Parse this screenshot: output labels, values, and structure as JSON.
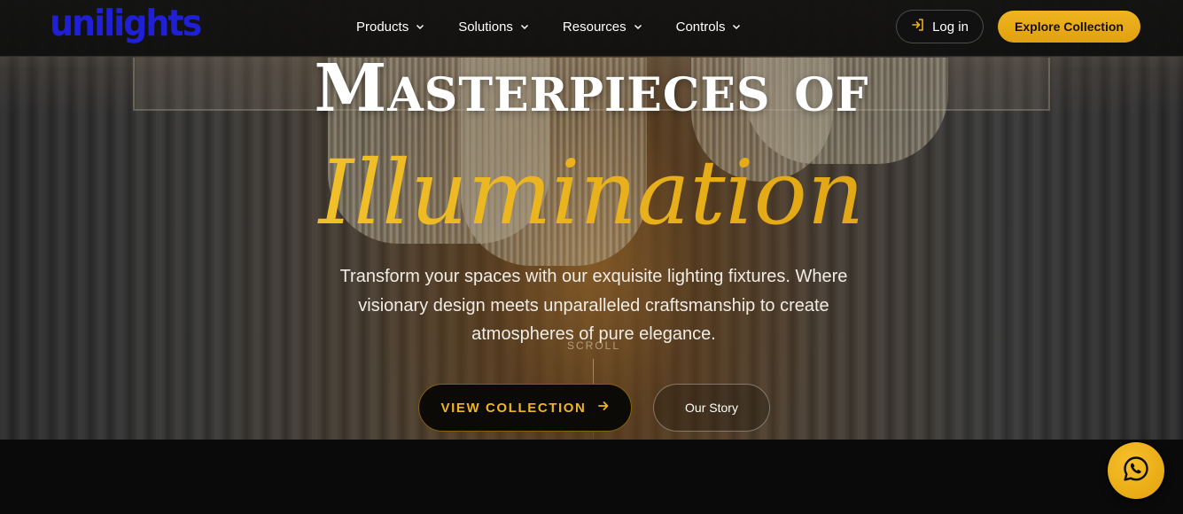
{
  "nav": {
    "logo_text": "unilights",
    "menu": [
      {
        "label": "Products"
      },
      {
        "label": "Solutions"
      },
      {
        "label": "Resources"
      },
      {
        "label": "Controls"
      }
    ],
    "login_label": "Log in",
    "explore_label": "Explore Collection"
  },
  "hero": {
    "headline": "Masterpieces of",
    "headline_accent": "Illumination",
    "subtitle": "Transform your spaces with our exquisite lighting fixtures. Where visionary design meets unparalleled craftsmanship to create atmospheres of pure elegance.",
    "scroll_label": "SCROLL",
    "primary_cta": "VIEW COLLECTION",
    "secondary_cta": "Our Story"
  },
  "colors": {
    "accent_gold": "#e8b11c",
    "logo_blue": "#1f1fd6",
    "nav_bg": "#0e0e0e"
  },
  "icons": {
    "login": "login-arrow-icon",
    "cta_arrow": "arrow-right-icon",
    "chat": "whatsapp-icon",
    "dropdown": "chevron-down-icon"
  }
}
